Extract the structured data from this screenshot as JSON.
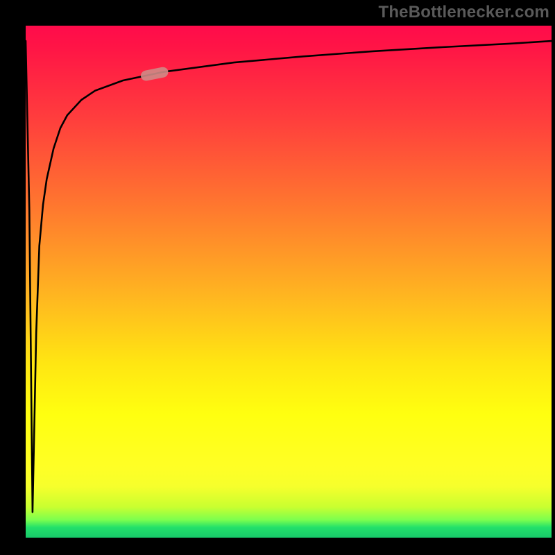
{
  "watermark": "TheBottlenecker.com",
  "chart_data": {
    "type": "line",
    "title": "",
    "xlabel": "",
    "ylabel": "",
    "xlim": [
      0,
      100
    ],
    "ylim": [
      0,
      100
    ],
    "grid": false,
    "legend": false,
    "series": [
      {
        "name": "bottleneck-curve",
        "comment": "Curve starts near top-left, plunges to the bottom in a narrow spike near x≈1–2, then recovers along a log-like curve toward y≈97 at the right edge. y estimated from pixel positions (100 = top).",
        "x": [
          0.0,
          0.7,
          1.3,
          2.0,
          2.6,
          3.3,
          4.0,
          5.3,
          6.6,
          7.9,
          10.6,
          13.2,
          18.5,
          26.4,
          39.6,
          52.8,
          66.0,
          79.2,
          92.3,
          100.0
        ],
        "values": [
          97.0,
          64.0,
          5.0,
          40.0,
          57.0,
          65.0,
          70.0,
          76.0,
          80.0,
          82.5,
          85.5,
          87.3,
          89.3,
          91.0,
          92.8,
          94.0,
          95.0,
          95.8,
          96.5,
          97.0
        ]
      }
    ],
    "annotations": [
      {
        "name": "highlight-pill",
        "comment": "Small rounded highlight riding on the curve near x≈22–27.",
        "x_range": [
          22,
          27
        ],
        "y_approx": 90,
        "color": "#cf8a86"
      }
    ],
    "background_gradient": {
      "top": "#ff0b4b",
      "mid_upper": "#ff7a2e",
      "mid": "#ffe612",
      "lower": "#ffff25",
      "bottom": "#18c96a"
    }
  }
}
